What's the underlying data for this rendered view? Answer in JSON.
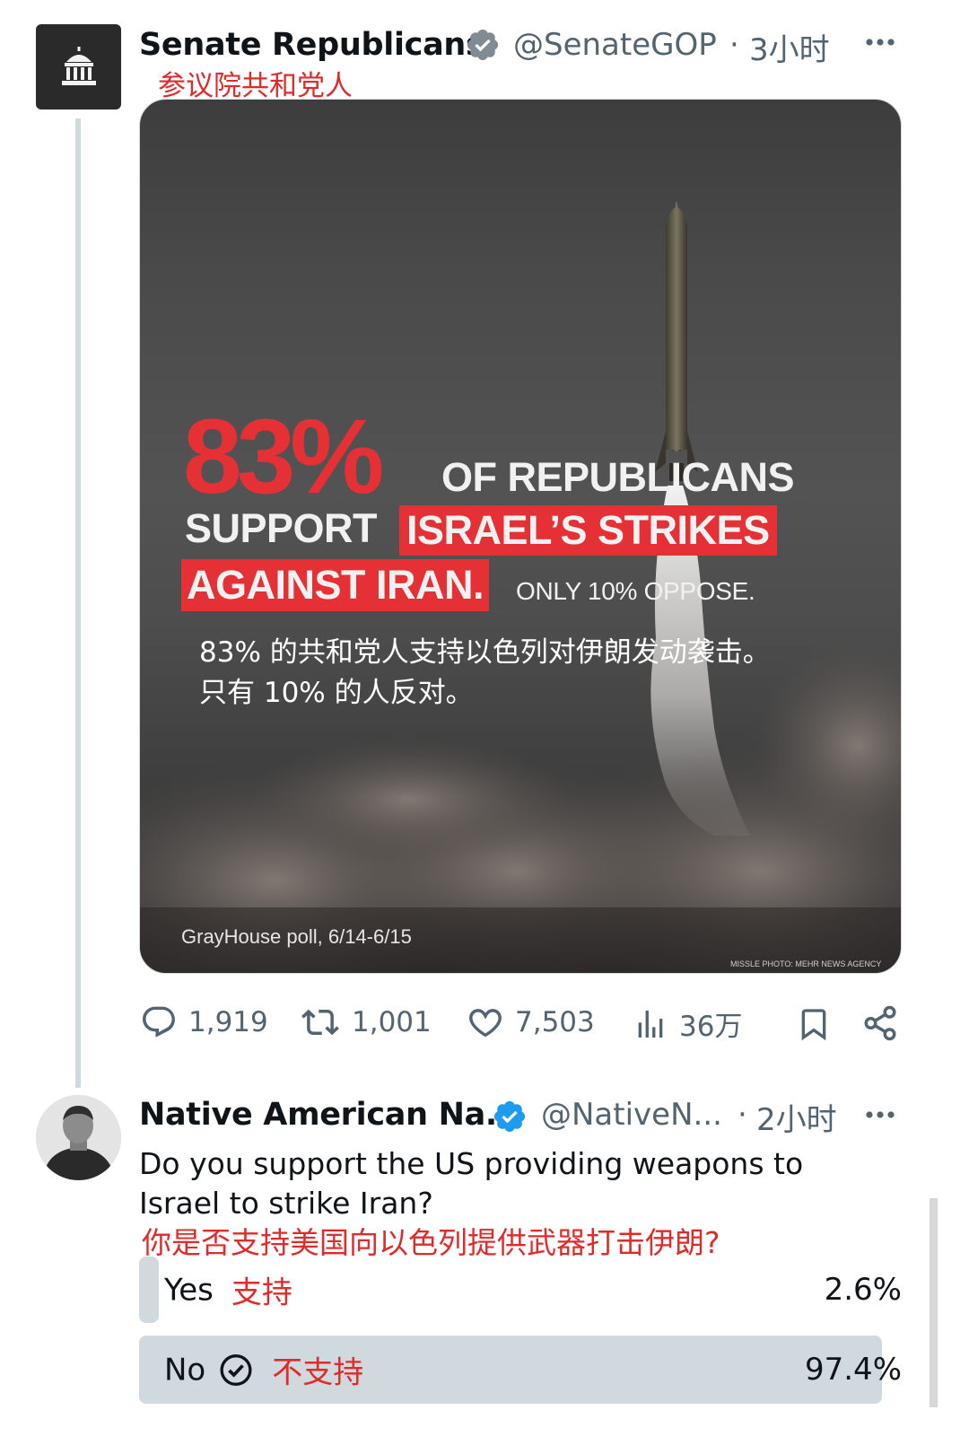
{
  "tweet1": {
    "display_name": "Senate Republicans",
    "handle": "@SenateGOP",
    "separator": "·",
    "time": "3小时",
    "name_translation": "参议院共和党人",
    "media": {
      "big_stat": "83%",
      "line1": "OF REPUBLICANS",
      "line2a": "SUPPORT",
      "line2b": "ISRAEL’S STRIKES",
      "line3a": "AGAINST IRAN.",
      "line3b": "ONLY 10% OPPOSE.",
      "translation_line1": "83% 的共和党人支持以色列对伊朗发动袭击。",
      "translation_line2": "只有 10% 的人反对。",
      "source": "GrayHouse poll, 6/14-6/15",
      "photo_credit": "MISSLE PHOTO: MEHR NEWS AGENCY"
    },
    "stats": {
      "replies": "1,919",
      "retweets": "1,001",
      "likes": "7,503",
      "views": "36万"
    }
  },
  "tweet2": {
    "display_name": "Native American Na...",
    "handle": "@NativeN...",
    "separator": "·",
    "time": "2小时",
    "question": "Do you support the US providing weapons to Israel to strike Iran?",
    "question_translation": "你是否支持美国向以色列提供武器打击伊朗?",
    "poll": [
      {
        "label": "Yes",
        "translation": "支持",
        "percent": "2.6%",
        "fraction": 0.026,
        "selected": false
      },
      {
        "label": "No",
        "translation": "不支持",
        "percent": "97.4%",
        "fraction": 0.974,
        "selected": true
      }
    ]
  },
  "colors": {
    "verified_blue": "#1d9bf0",
    "secondary_text": "#536471",
    "translation_red": "#e12a2a",
    "headline_red": "#e53135",
    "poll_bar": "#cfd9de"
  },
  "icons": [
    "capitol-icon",
    "verified-badge-icon",
    "more-icon",
    "reply-icon",
    "retweet-icon",
    "like-icon",
    "views-icon",
    "bookmark-icon",
    "share-icon",
    "check-circle-icon"
  ]
}
